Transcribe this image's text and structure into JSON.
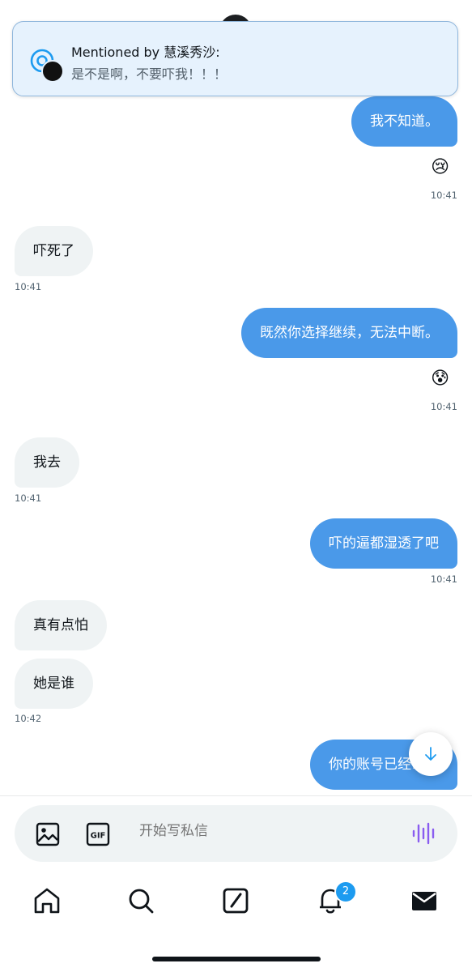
{
  "notification": {
    "title": "Mentioned by 慧溪秀沙:",
    "message": "是不是啊，不要吓我！！！"
  },
  "messages": [
    {
      "side": "out",
      "text": "我不知道。",
      "reaction": "😢",
      "time": "10:41"
    },
    {
      "side": "in",
      "text": "吓死了",
      "time": "10:41"
    },
    {
      "side": "out",
      "text": "既然你选择继续，无法中断。",
      "reaction": "😰",
      "time": "10:41"
    },
    {
      "side": "in",
      "text": "我去",
      "time": "10:41"
    },
    {
      "side": "out",
      "text": "吓的逼都湿透了吧",
      "time": "10:41"
    },
    {
      "side": "in",
      "text": "真有点怕"
    },
    {
      "side": "in",
      "text": "她是谁",
      "time": "10:42"
    },
    {
      "side": "out",
      "text": "你的账号已经公开"
    }
  ],
  "composer": {
    "placeholder": "开始写私信",
    "image_icon": "image-icon",
    "gif_icon": "gif-icon",
    "gif_label": "GIF",
    "voice_icon": "voice-waveform-icon"
  },
  "nav": {
    "items": [
      "home-icon",
      "search-icon",
      "compose-icon",
      "notifications-icon",
      "messages-icon"
    ],
    "notification_badge": "2"
  },
  "colors": {
    "accent": "#1d9bf0",
    "outgoing_bubble": "#4a99e9",
    "incoming_bubble": "#eff3f4",
    "voice_icon": "#8a5cf0"
  }
}
